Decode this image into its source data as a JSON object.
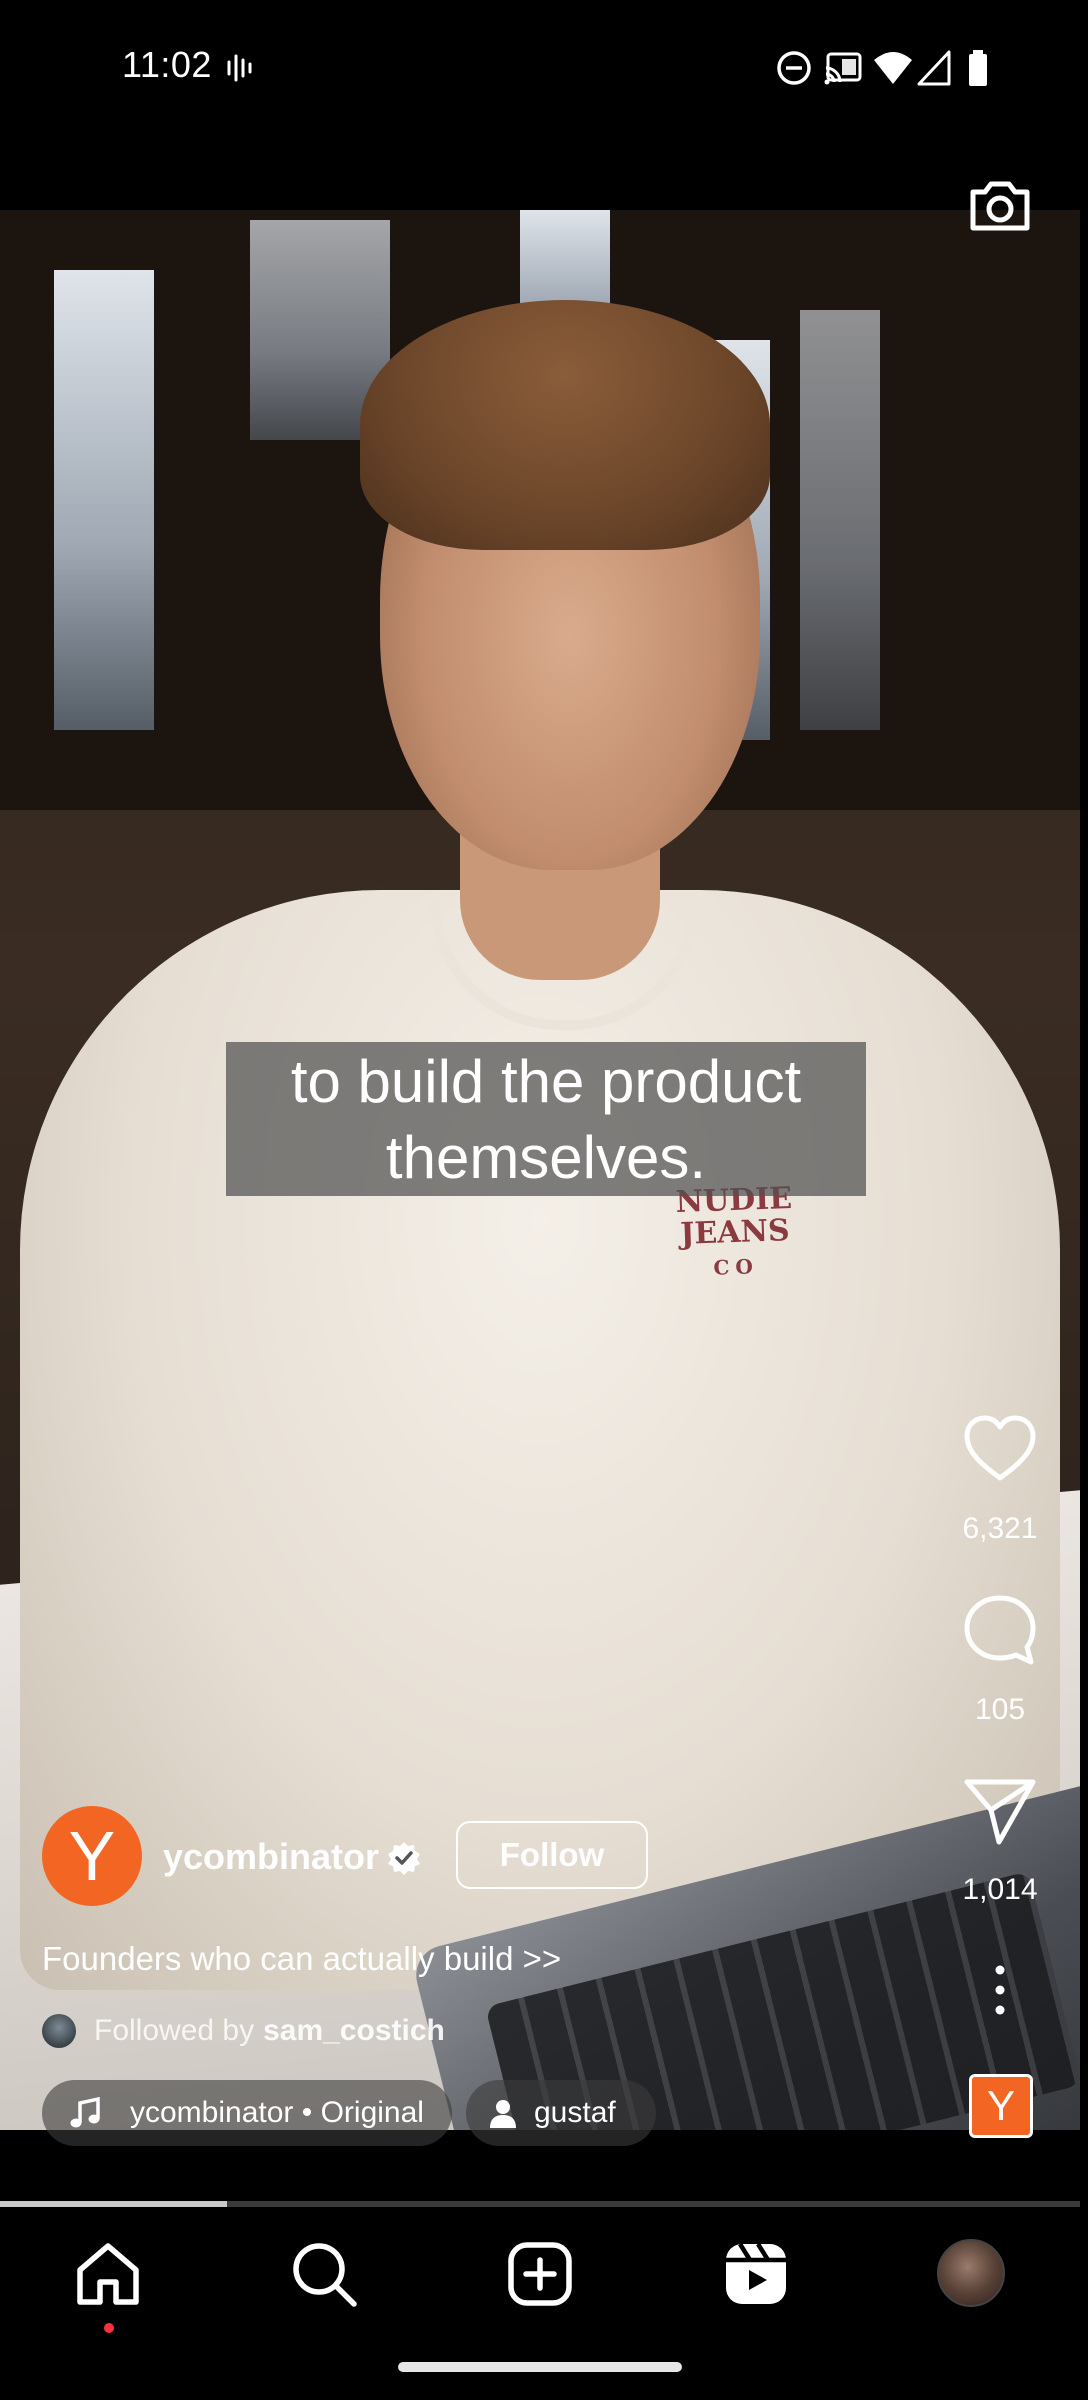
{
  "status_bar": {
    "time": "11:02",
    "icons": [
      "voice-activity-icon",
      "do-not-disturb-icon",
      "cast-icon",
      "wifi-icon",
      "signal-icon",
      "battery-icon"
    ]
  },
  "video": {
    "caption_line1": "to build the product",
    "caption_line2": "themselves.",
    "progress": 0.21
  },
  "actions": {
    "likes": "6,321",
    "comments": "105",
    "shares": "1,014"
  },
  "author": {
    "avatar_letter": "Y",
    "username": "ycombinator",
    "verified": true,
    "follow_label": "Follow",
    "brand_color": "#f26522"
  },
  "post": {
    "description": "Founders who can actually build >>",
    "followed_by_prefix": "Followed by",
    "followed_by_user": "sam_costich"
  },
  "chips": {
    "audio_label": "ycombinator • Original",
    "tagged_user": "gustaf"
  },
  "audio_thumb_letter": "Y",
  "bottom_nav": {
    "items": [
      "home-icon",
      "search-icon",
      "create-icon",
      "reels-icon",
      "profile-avatar"
    ],
    "active": "home"
  }
}
